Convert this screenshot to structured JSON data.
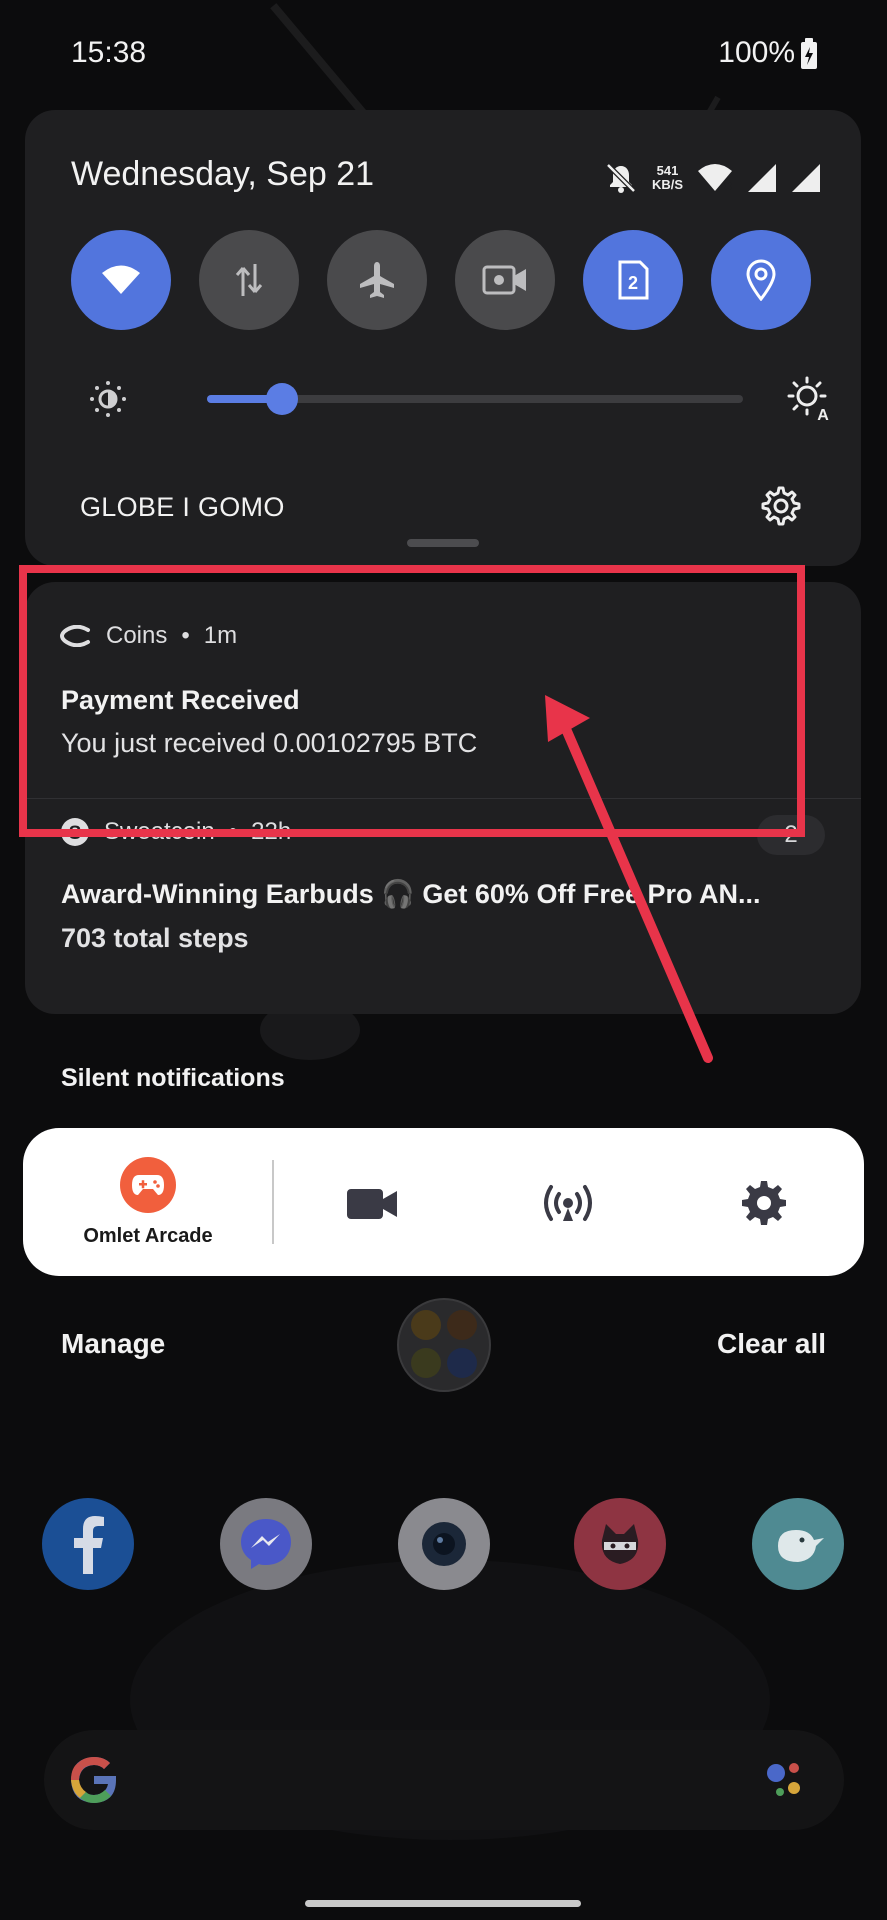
{
  "status_bar": {
    "time": "15:38",
    "battery": "100%"
  },
  "quick_settings": {
    "date": "Wednesday, Sep 21",
    "network_speed": {
      "value": "541",
      "unit": "KB/S"
    },
    "tiles": [
      {
        "name": "wifi",
        "on": true
      },
      {
        "name": "mobile-data",
        "on": false
      },
      {
        "name": "airplane-mode",
        "on": false
      },
      {
        "name": "screen-record",
        "on": false
      },
      {
        "name": "sim-2",
        "on": true,
        "label": "2"
      },
      {
        "name": "location",
        "on": true
      }
    ],
    "brightness_level": 0.14,
    "carrier": "GLOBE I GOMO"
  },
  "notifications": [
    {
      "app": "Coins",
      "time": "1m",
      "separator": "•",
      "title": "Payment Received",
      "body": "You just received 0.00102795 BTC"
    },
    {
      "app": "Sweatcoin",
      "time": "22h",
      "separator": "•",
      "count": "2",
      "title": "Award-Winning Earbuds 🎧 Get 60% Off Free Pro AN...",
      "body": "703 total steps"
    }
  ],
  "silent_section": {
    "label": "Silent notifications",
    "app_label": "Omlet Arcade"
  },
  "footer": {
    "manage": "Manage",
    "clear_all": "Clear all"
  },
  "colors": {
    "accent": "#5275dd",
    "highlight": "#e8344a",
    "panel": "#1f1f21"
  }
}
